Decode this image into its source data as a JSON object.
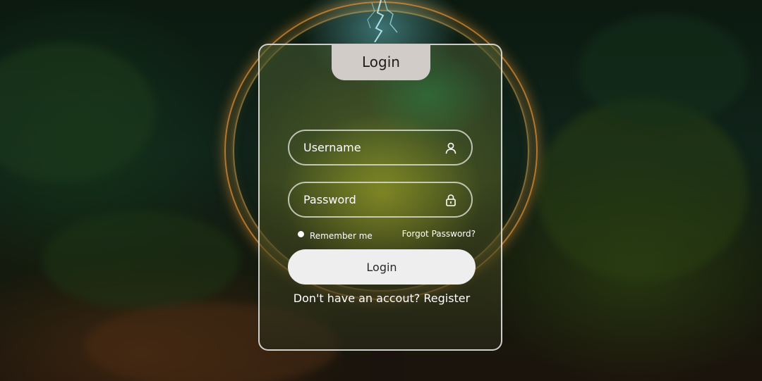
{
  "form": {
    "title": "Login",
    "username_placeholder": "Username",
    "password_placeholder": "Password",
    "remember_label": "Remember me",
    "forgot_label": "Forgot Password?",
    "submit_label": "Login",
    "register_prompt": "Don't have an accout?",
    "register_link": "Register"
  },
  "icons": {
    "username": "user-icon",
    "password": "lock-icon"
  },
  "colors": {
    "tab": "#d2ccc9",
    "button": "#efeeee",
    "border": "#ebebeb"
  }
}
